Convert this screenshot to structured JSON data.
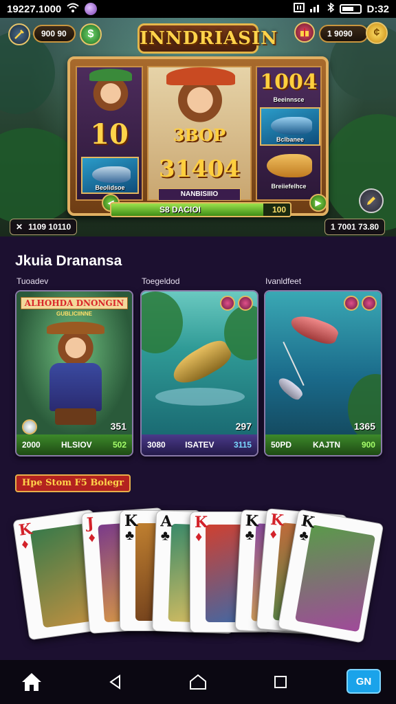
{
  "status_bar": {
    "time": "19227.1000",
    "right_time": "D:32"
  },
  "hero": {
    "game_title": "INNDRIASIN",
    "left_balance": "900 90",
    "right_balance": "1 9090",
    "slot": {
      "left_number": "10",
      "center_top_label": "3BOP",
      "center_number": "31404",
      "right_number": "1004",
      "right_label": "Beeinnsce",
      "left_fish_label": "Beolidsoe",
      "right_fish_label": "Bclbanee",
      "right_fish2_label": "Breiiefelhce",
      "center_plate": "NANBISIIIO",
      "progress_label": "S8 DACIOI",
      "progress_value": "100",
      "progress_fraction": 0.85
    },
    "bottom_left": "1109 10110",
    "bottom_right": "1 7001 73.80"
  },
  "section": {
    "title": "Jkuia Dranansa",
    "columns": [
      {
        "label": "Tuoadev",
        "banner": "ALHOHDA DNONGIN",
        "subbanner": "GUBLICIINNE",
        "score": "351",
        "bar_left": "2000",
        "bar_mid": "HLSIOV",
        "bar_right": "502"
      },
      {
        "label": "Toegeldod",
        "score": "297",
        "bar_left": "3080",
        "bar_mid": "ISATEV",
        "bar_right": "3115"
      },
      {
        "label": "Ivanldfeet",
        "score": "1365",
        "bar_left": "50PD",
        "bar_mid": "KAJTN",
        "bar_right": "900"
      }
    ],
    "offer": "Hpe Stom F5 Bolegr"
  },
  "cards": [
    {
      "rank": "K",
      "suit": "♦",
      "color": "red"
    },
    {
      "rank": "J",
      "suit": "♦",
      "color": "red"
    },
    {
      "rank": "K",
      "suit": "♣",
      "color": "black"
    },
    {
      "rank": "A",
      "suit": "♣",
      "color": "black"
    },
    {
      "rank": "K",
      "suit": "♦",
      "color": "red"
    },
    {
      "rank": "K",
      "suit": "♣",
      "color": "black"
    },
    {
      "rank": "K",
      "suit": "♦",
      "color": "red"
    },
    {
      "rank": "K",
      "suit": "♣",
      "color": "black"
    }
  ],
  "nav": {
    "cn_button": "GN"
  },
  "colors": {
    "background": "#1c1030",
    "gold": "#e3b760",
    "accent_blue": "#1aa3ea",
    "progress_green": "#3f8d16"
  },
  "icons": [
    "wifi-icon",
    "battery-icon",
    "sword-icon",
    "coin-icon",
    "gift-icon",
    "home-icon",
    "back-icon",
    "circle-home-icon",
    "recents-icon"
  ]
}
